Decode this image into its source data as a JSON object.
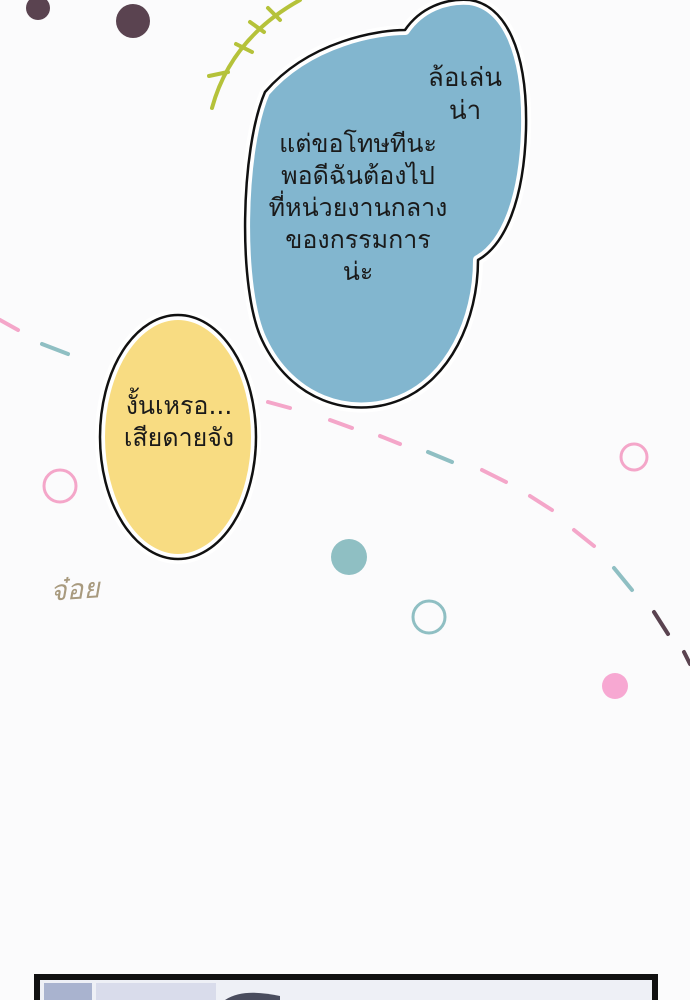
{
  "bubbles": {
    "blue_corner": "ล้อเล่น\nน่า",
    "blue_main": "แต่ขอโทษทีนะ\nพอดีฉันต้องไป\nที่หน่วยงานกลาง\nของกรรมการ\nน่ะ",
    "yellow": "งั้นเหรอ...\nเสียดายจัง"
  },
  "sfx": "จ๋อย",
  "colors": {
    "blue_bubble": "#82b6cf",
    "yellow_bubble": "#f8dc82",
    "dash_pink": "#f4a6c9",
    "dash_teal": "#8fbfc3",
    "dot_dark": "#5a4350",
    "dot_pink": "#f7a8d2",
    "dot_teal": "#8fbfc3",
    "accent_green": "#b5c23a"
  }
}
